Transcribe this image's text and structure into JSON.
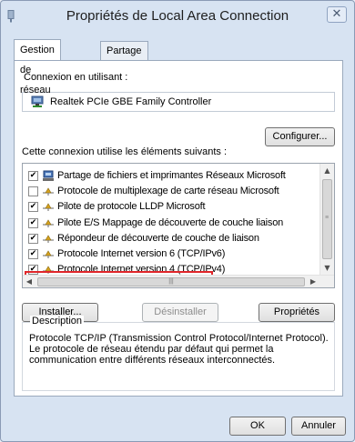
{
  "window": {
    "title": "Propriétés de Local Area Connection",
    "close_glyph": "✕"
  },
  "tabs": [
    {
      "label": "Gestion de réseau"
    },
    {
      "label": "Partage"
    }
  ],
  "connect_using": {
    "label": "Connexion en utilisant :",
    "adapter": "Realtek PCIe GBE Family Controller",
    "configure_label": "Configurer..."
  },
  "items_section": {
    "label": "Cette connexion utilise les éléments suivants :",
    "items": [
      {
        "label": "Partage de fichiers et imprimantes Réseaux Microsoft",
        "checked": true,
        "icon": "network-share-icon"
      },
      {
        "label": "Protocole de multiplexage de carte réseau Microsoft",
        "checked": false,
        "icon": "protocol-icon"
      },
      {
        "label": "Pilote de protocole LLDP Microsoft",
        "checked": true,
        "icon": "protocol-icon"
      },
      {
        "label": "Pilote E/S Mappage de découverte de couche liaison",
        "checked": true,
        "icon": "protocol-icon"
      },
      {
        "label": "Répondeur de découverte de couche de liaison",
        "checked": true,
        "icon": "protocol-icon"
      },
      {
        "label": "Protocole Internet version 6 (TCP/IPv6)",
        "checked": true,
        "icon": "protocol-icon"
      },
      {
        "label": "Protocole Internet version 4 (TCP/IPv4)",
        "checked": true,
        "icon": "protocol-icon"
      }
    ],
    "highlighted_item": "Protocole Internet version 4 (TCP/IPv4)",
    "highlight_color": "#e0262a"
  },
  "item_buttons": {
    "install": "Installer...",
    "uninstall": "Désinstaller",
    "properties": "Propriétés"
  },
  "description": {
    "legend": "Description",
    "text": "Protocole TCP/IP (Transmission Control Protocol/Internet Protocol). Le protocole de réseau étendu par défaut qui permet la communication entre différents réseaux interconnectés."
  },
  "footer": {
    "ok": "OK",
    "cancel": "Annuler"
  },
  "check_glyph": "✔"
}
